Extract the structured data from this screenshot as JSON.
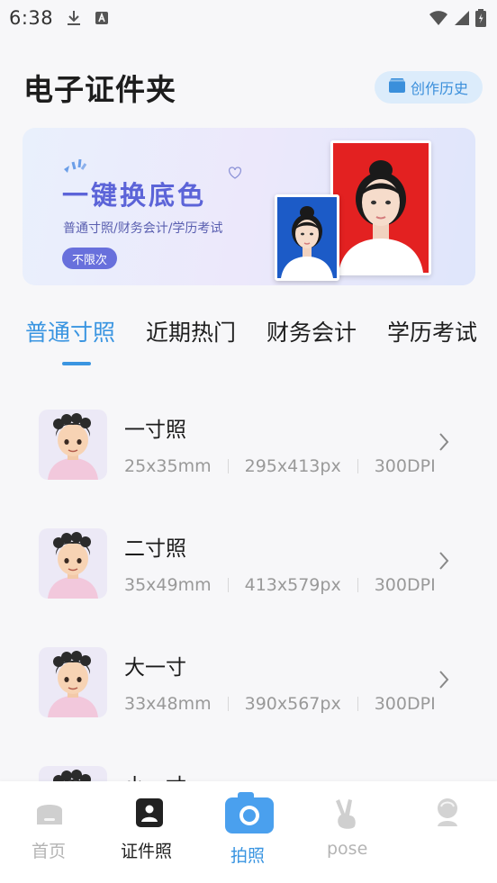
{
  "status_bar": {
    "time": "6:38",
    "icons": [
      "download-icon",
      "a-badge-icon",
      "wifi-icon",
      "signal-icon",
      "battery-icon"
    ]
  },
  "header": {
    "title": "电子证件夹",
    "history_label": "创作历史",
    "accent": "#3b8fdb"
  },
  "banner": {
    "title": "一键换底色",
    "subtitle": "普通寸照/财务会计/学历考试",
    "pill": "不限次",
    "photo_colors": [
      "#e32121",
      "#1c5bc7"
    ]
  },
  "tabs": [
    {
      "label": "普通寸照",
      "active": true
    },
    {
      "label": "近期热门",
      "active": false
    },
    {
      "label": "财务会计",
      "active": false
    },
    {
      "label": "学历考试",
      "active": false
    }
  ],
  "items": [
    {
      "title": "一寸照",
      "size": "25x35mm",
      "pixels": "295x413px",
      "dpi": "300DPI"
    },
    {
      "title": "二寸照",
      "size": "35x49mm",
      "pixels": "413x579px",
      "dpi": "300DPI"
    },
    {
      "title": "大一寸",
      "size": "33x48mm",
      "pixels": "390x567px",
      "dpi": "300DPI"
    },
    {
      "title": "小一寸"
    }
  ],
  "bottom_nav": [
    {
      "label": "首页",
      "icon": "home-icon"
    },
    {
      "label": "证件照",
      "icon": "id-card-icon",
      "active": true
    },
    {
      "label": "拍照",
      "icon": "camera-icon"
    },
    {
      "label": "pose",
      "icon": "peace-hand-icon"
    },
    {
      "label": "",
      "icon": "avatar-icon"
    }
  ]
}
